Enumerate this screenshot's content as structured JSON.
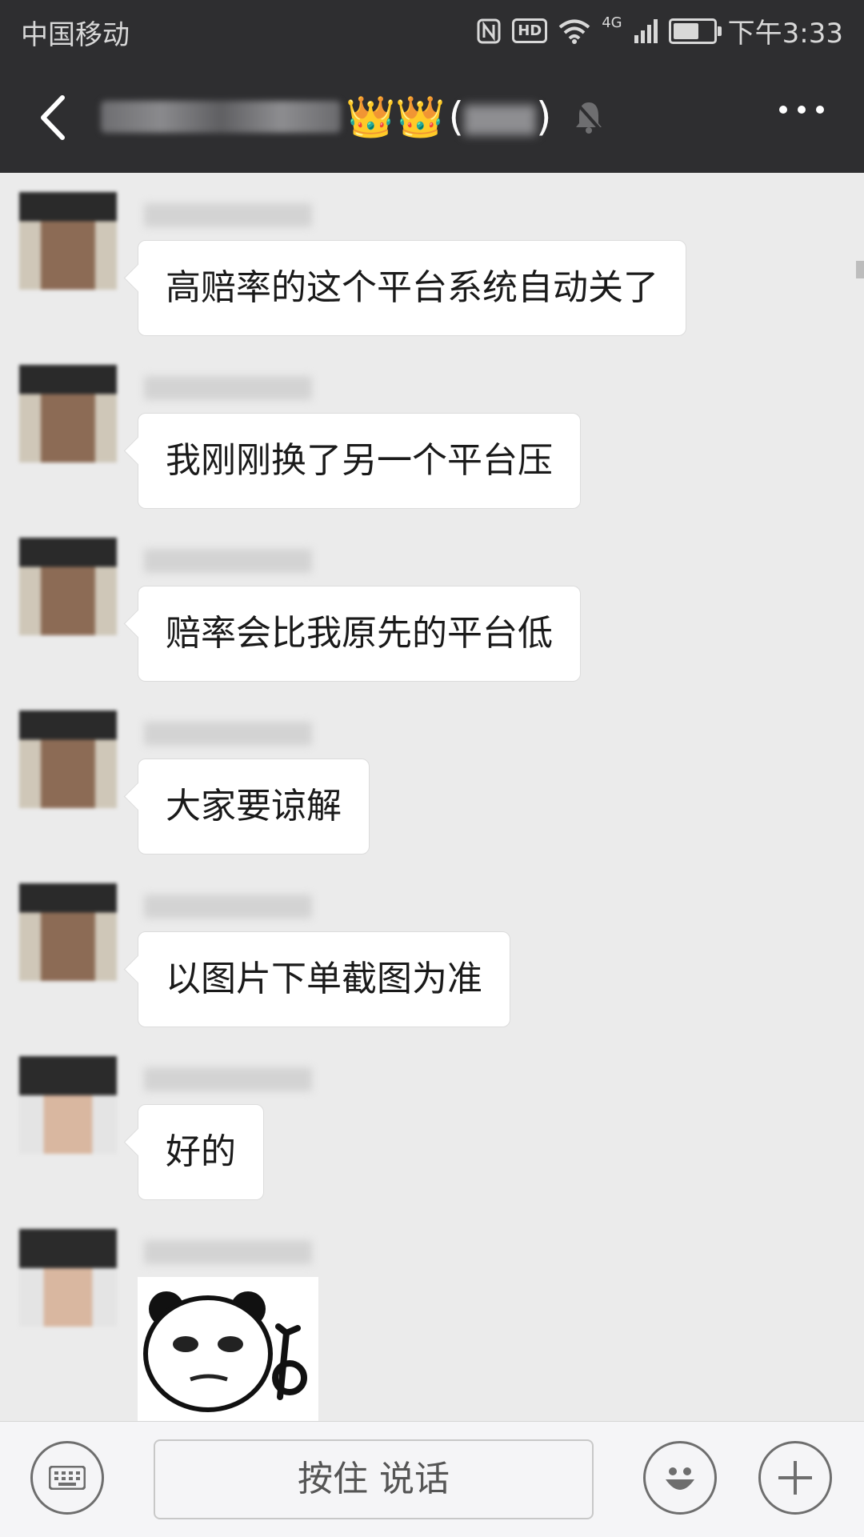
{
  "status_bar": {
    "carrier": "中国移动",
    "network_badge": "HD",
    "signal_label": "4G",
    "time": "下午3:33",
    "battery_level": 0.7,
    "icons": [
      "nfc-icon",
      "hd-icon",
      "wifi-icon",
      "signal-icon",
      "battery-icon"
    ]
  },
  "nav": {
    "back_icon": "chevron-left-icon",
    "title_emoji": "👑👑",
    "title_count_open": "(",
    "title_count_close": ")",
    "mute_icon": "bell-muted-icon",
    "more_icon": "more-dots-icon"
  },
  "messages": [
    {
      "text": "高赔率的这个平台系统自动关了"
    },
    {
      "text": "我刚刚换了另一个平台压"
    },
    {
      "text": "赔率会比我原先的平台低"
    },
    {
      "text": "大家要谅解"
    },
    {
      "text": "以图片下单截图为准"
    },
    {
      "text": "好的"
    },
    {
      "sticker": "panda-ok-sticker"
    }
  ],
  "input_bar": {
    "keyboard_icon": "keyboard-icon",
    "voice_label": "按住 说话",
    "emoji_icon": "emoji-icon",
    "plus_icon": "plus-icon"
  },
  "colors": {
    "header_bg": "#2e2e30",
    "chat_bg": "#ebebeb",
    "bubble_bg": "#ffffff",
    "input_bg": "#f5f5f7"
  }
}
